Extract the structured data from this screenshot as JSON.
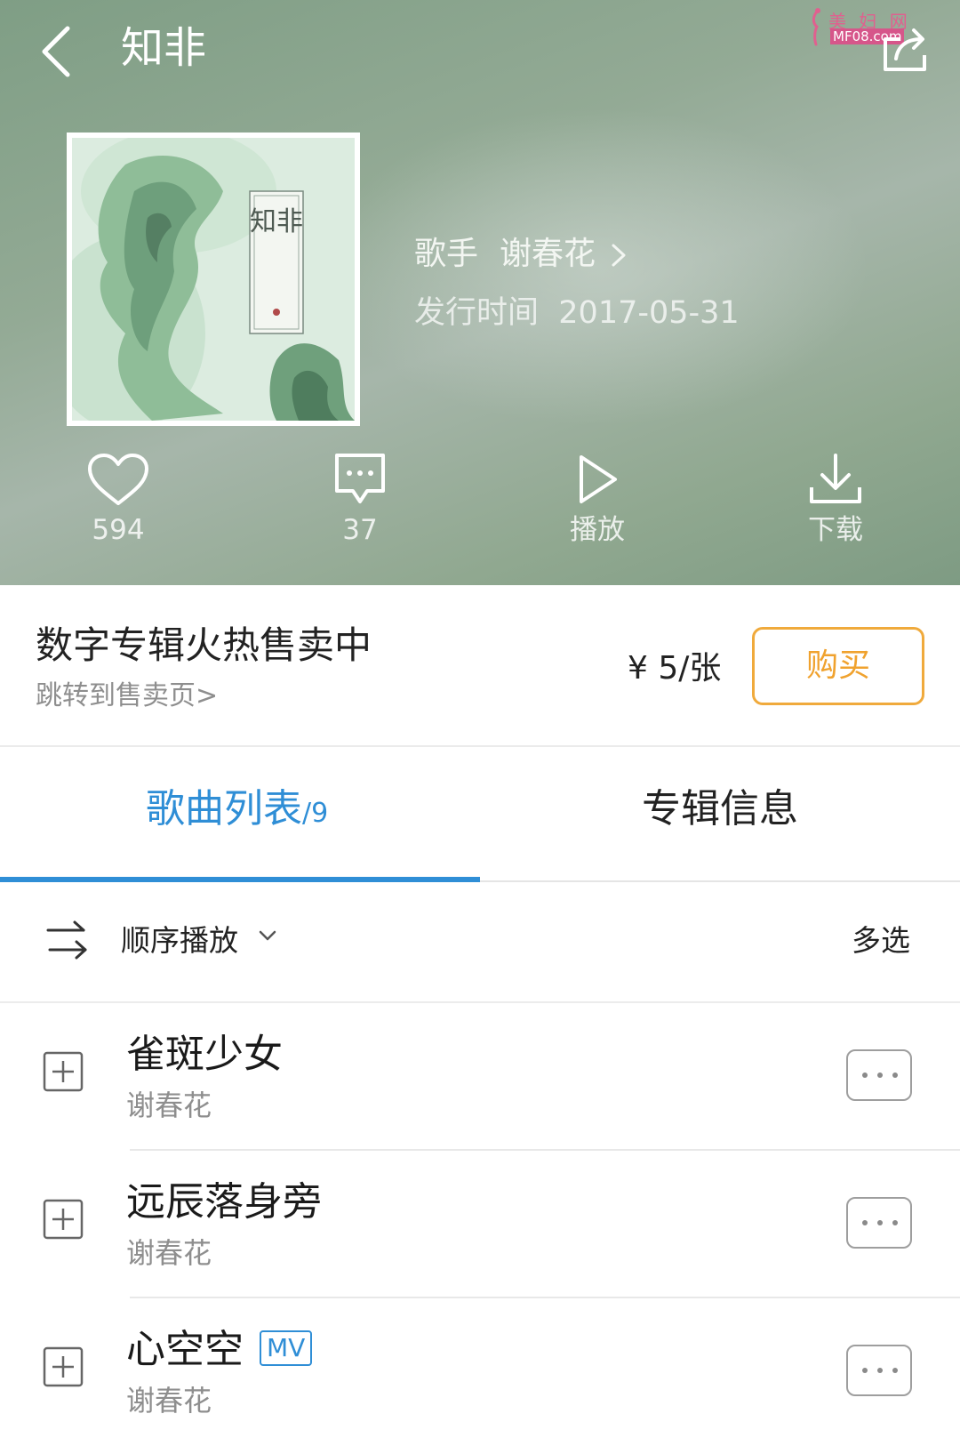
{
  "header": {
    "title": "知非",
    "watermark_line1": "美 妇 网",
    "watermark_line2": "MF08.com",
    "back_icon": "back-chevron-icon",
    "share_icon": "share-icon"
  },
  "album": {
    "cover_title": "知非",
    "artist_label": "歌手",
    "artist_name": "谢春花",
    "release_label": "发行时间",
    "release_date": "2017-05-31"
  },
  "actions": [
    {
      "icon": "heart-icon",
      "label": "594"
    },
    {
      "icon": "comment-icon",
      "label": "37"
    },
    {
      "icon": "play-icon",
      "label": "播放"
    },
    {
      "icon": "download-icon",
      "label": "下载"
    }
  ],
  "purchase": {
    "title": "数字专辑火热售卖中",
    "link": "跳转到售卖页>",
    "price": "¥ 5/张",
    "buy_label": "购买"
  },
  "tabs": {
    "songs_label": "歌曲列表",
    "songs_count": "/9",
    "info_label": "专辑信息"
  },
  "playlist_bar": {
    "mode_label": "顺序播放",
    "multi_select": "多选"
  },
  "songs": [
    {
      "title": "雀斑少女",
      "artist": "谢春花",
      "mv": ""
    },
    {
      "title": "远辰落身旁",
      "artist": "谢春花",
      "mv": ""
    },
    {
      "title": "心空空",
      "artist": "谢春花",
      "mv": "MV"
    }
  ],
  "colors": {
    "accent_blue": "#2f8ed6",
    "buy_orange": "#f0aa3c",
    "header_green": "#8fa993"
  }
}
